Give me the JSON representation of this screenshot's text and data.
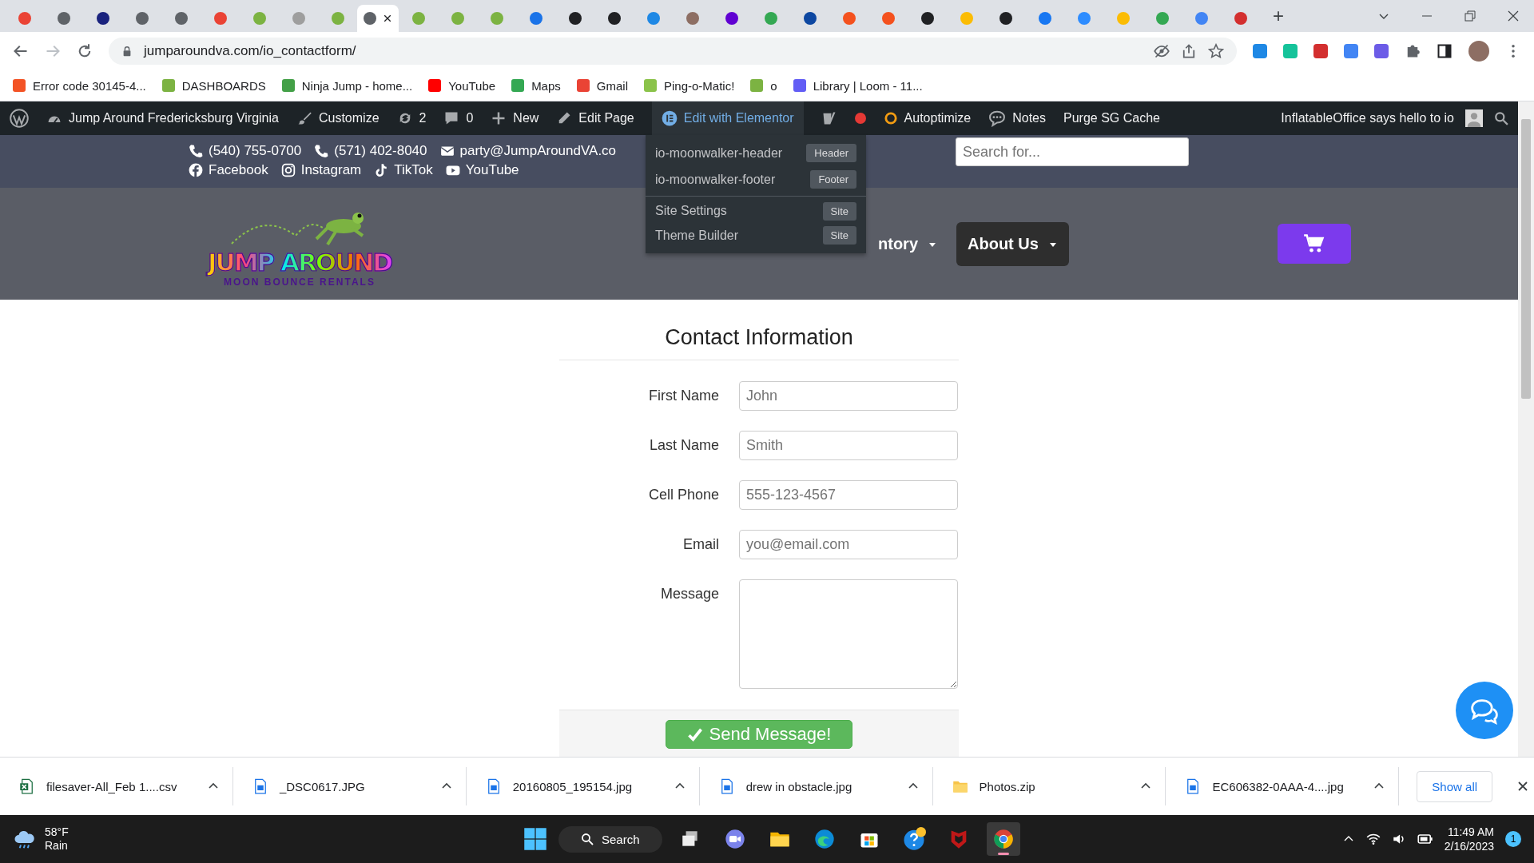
{
  "browser": {
    "tabs": [
      {
        "color": "#ea4335",
        "selected": false
      },
      {
        "color": "#5f6368",
        "selected": false
      },
      {
        "color": "#1a237e",
        "selected": false
      },
      {
        "color": "#5f6368",
        "selected": false
      },
      {
        "color": "#5f6368",
        "selected": false
      },
      {
        "color": "#ea4335",
        "selected": false
      },
      {
        "color": "#7cb342",
        "selected": false
      },
      {
        "color": "#9e9e9e",
        "selected": false
      },
      {
        "color": "#7cb342",
        "selected": false
      },
      {
        "color": "#5f6368",
        "selected": true
      },
      {
        "color": "#7cb342",
        "selected": false
      },
      {
        "color": "#7cb342",
        "selected": false
      },
      {
        "color": "#7cb342",
        "selected": false
      },
      {
        "color": "#1a73e8",
        "selected": false
      },
      {
        "color": "#202124",
        "selected": false
      },
      {
        "color": "#202124",
        "selected": false
      },
      {
        "color": "#1e88e5",
        "selected": false
      },
      {
        "color": "#8d6e63",
        "selected": false
      },
      {
        "color": "#6001d2",
        "selected": false
      },
      {
        "color": "#34a853",
        "selected": false
      },
      {
        "color": "#0d47a1",
        "selected": false
      },
      {
        "color": "#f4511e",
        "selected": false
      },
      {
        "color": "#f4511e",
        "selected": false
      },
      {
        "color": "#202124",
        "selected": false
      },
      {
        "color": "#fbbc04",
        "selected": false
      },
      {
        "color": "#202124",
        "selected": false
      },
      {
        "color": "#1877f2",
        "selected": false
      },
      {
        "color": "#2d8cff",
        "selected": false
      },
      {
        "color": "#fbbc04",
        "selected": false
      },
      {
        "color": "#34a853",
        "selected": false
      },
      {
        "color": "#4285f4",
        "selected": false
      },
      {
        "color": "#d32f2f",
        "selected": false
      }
    ],
    "new_tab": "+",
    "address": "jumparoundva.com/io_contactform/",
    "extensions": [
      {
        "color": "#1e88e5"
      },
      {
        "color": "#15c39a"
      },
      {
        "color": "#d32f2f"
      },
      {
        "color": "#4285f4"
      },
      {
        "color": "#6c5ce7"
      }
    ],
    "bookmarks": [
      {
        "label": "Error code 30145-4...",
        "color": "#f35325"
      },
      {
        "label": "DASHBOARDS",
        "color": "#7cb342"
      },
      {
        "label": "Ninja Jump - home...",
        "color": "#43a047"
      },
      {
        "label": "YouTube",
        "color": "#ff0000"
      },
      {
        "label": "Maps",
        "color": "#34a853"
      },
      {
        "label": "Gmail",
        "color": "#ea4335"
      },
      {
        "label": "Ping-o-Matic!",
        "color": "#8bc34a"
      },
      {
        "label": "o",
        "color": "#7cb342"
      },
      {
        "label": "Library | Loom - 11...",
        "color": "#625df5"
      }
    ]
  },
  "admin_bar": {
    "items": [
      {
        "kind": "site",
        "label": "Jump Around Fredericksburg Virginia",
        "selected": false
      },
      {
        "kind": "customize",
        "label": "Customize",
        "selected": false
      },
      {
        "kind": "updates",
        "label": "2",
        "selected": false
      },
      {
        "kind": "comments",
        "label": "0",
        "selected": false
      },
      {
        "kind": "new",
        "label": "New",
        "selected": false
      },
      {
        "kind": "edit",
        "label": "Edit Page",
        "selected": false
      },
      {
        "kind": "elementor",
        "label": "Edit with Elementor",
        "selected": true
      },
      {
        "kind": "yoast",
        "selected": false
      },
      {
        "kind": "recording",
        "selected": false
      },
      {
        "kind": "autoptimize",
        "label": "Autoptimize",
        "selected": false
      },
      {
        "kind": "notes",
        "label": "Notes",
        "selected": false
      },
      {
        "kind": "plain",
        "label": "Purge SG Cache",
        "selected": false
      }
    ],
    "greeting": "InflatableOffice says hello to io"
  },
  "elementor_menu": [
    {
      "label": "io-moonwalker-header",
      "badge": "Header"
    },
    {
      "label": "io-moonwalker-footer",
      "badge": "Footer"
    },
    {
      "label": "Site Settings",
      "badge": "Site"
    },
    {
      "label": "Theme Builder",
      "badge": "Site"
    }
  ],
  "top_bar": {
    "contacts": [
      {
        "kind": "phone",
        "label": "(540) 755-0700"
      },
      {
        "kind": "phone",
        "label": "(571) 402-8040"
      },
      {
        "kind": "email",
        "label": "party@JumpAroundVA.co"
      }
    ],
    "social": [
      {
        "kind": "facebook",
        "label": "Facebook"
      },
      {
        "kind": "instagram",
        "label": "Instagram"
      },
      {
        "kind": "tiktok",
        "label": "TikTok"
      },
      {
        "kind": "youtube",
        "label": "YouTube"
      }
    ],
    "search": {
      "placeholder": "Search for..."
    }
  },
  "header": {
    "logo": {
      "title": "JUMP AROUND",
      "tagline": "MOON BOUNCE RENTALS"
    },
    "nav": [
      {
        "label": "ntory",
        "kind": "plain"
      },
      {
        "label": "About Us",
        "kind": "boxed"
      }
    ]
  },
  "form": {
    "title": "Contact Information",
    "fields": [
      {
        "label": "First Name",
        "placeholder": "John",
        "kind": "text"
      },
      {
        "label": "Last Name",
        "placeholder": "Smith",
        "kind": "text"
      },
      {
        "label": "Cell Phone",
        "placeholder": "555-123-4567",
        "kind": "text"
      },
      {
        "label": "Email",
        "placeholder": "you@email.com",
        "kind": "text"
      },
      {
        "label": "Message",
        "kind": "textarea"
      }
    ],
    "submit": "Send Message!"
  },
  "downloads": {
    "items": [
      {
        "name": "filesaver-All_Feb 1....csv",
        "kind": "excel"
      },
      {
        "name": "_DSC0617.JPG",
        "kind": "file"
      },
      {
        "name": "20160805_195154.jpg",
        "kind": "file"
      },
      {
        "name": "drew in obstacle.jpg",
        "kind": "file"
      },
      {
        "name": "Photos.zip",
        "kind": "folder"
      },
      {
        "name": "EC606382-0AAA-4....jpg",
        "kind": "file"
      }
    ],
    "show_all": "Show all"
  },
  "taskbar": {
    "weather": {
      "temp": "58°F",
      "condition": "Rain"
    },
    "search": "Search",
    "apps": [
      {
        "kind": "taskview",
        "selected": false
      },
      {
        "kind": "chat",
        "selected": false
      },
      {
        "kind": "explorer",
        "selected": false
      },
      {
        "kind": "edge",
        "selected": false
      },
      {
        "kind": "store",
        "selected": false
      },
      {
        "kind": "help",
        "selected": false
      },
      {
        "kind": "mcafee",
        "selected": false
      },
      {
        "kind": "chrome",
        "selected": true
      }
    ],
    "time": "11:49 AM",
    "date": "2/16/2023",
    "notifications": "1"
  }
}
